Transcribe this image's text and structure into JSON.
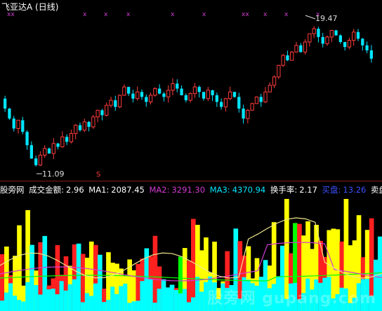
{
  "header": {
    "stock_name": "飞亚达A",
    "period": "(日线)"
  },
  "price_panel": {
    "high_label": "19.47",
    "low_label": "11.09",
    "sell_marker": "S",
    "colors": {
      "up": "#ff3c3c",
      "down": "#00e5ff",
      "signal": "#d23cd2"
    },
    "signals": [
      "xx",
      "x",
      "x",
      "x",
      "x",
      "x",
      "xx",
      "x",
      "x",
      "x"
    ],
    "candles": [
      [
        15.2,
        14.6
      ],
      [
        14.6,
        14.0
      ],
      [
        14.0,
        13.4
      ],
      [
        13.4,
        13.9
      ],
      [
        13.9,
        13.2
      ],
      [
        13.2,
        12.4
      ],
      [
        12.4,
        11.6
      ],
      [
        11.6,
        11.2
      ],
      [
        11.2,
        11.8
      ],
      [
        11.8,
        12.2
      ],
      [
        12.2,
        11.9
      ],
      [
        11.9,
        12.5
      ],
      [
        12.5,
        12.3
      ],
      [
        12.3,
        12.9
      ],
      [
        12.9,
        12.6
      ],
      [
        12.6,
        13.1
      ],
      [
        13.1,
        13.6
      ],
      [
        13.6,
        13.3
      ],
      [
        13.3,
        13.8
      ],
      [
        13.8,
        13.5
      ],
      [
        13.5,
        14.1
      ],
      [
        14.1,
        14.5
      ],
      [
        14.5,
        14.2
      ],
      [
        14.2,
        14.8
      ],
      [
        14.8,
        15.1
      ],
      [
        15.1,
        14.7
      ],
      [
        14.7,
        15.4
      ],
      [
        15.4,
        15.9
      ],
      [
        15.9,
        15.5
      ],
      [
        15.5,
        15.2
      ],
      [
        15.2,
        15.6
      ],
      [
        15.6,
        15.3
      ],
      [
        15.3,
        15.0
      ],
      [
        15.0,
        15.4
      ],
      [
        15.4,
        15.8
      ],
      [
        15.8,
        15.5
      ],
      [
        15.5,
        15.3
      ],
      [
        15.3,
        15.7
      ],
      [
        15.7,
        16.1
      ],
      [
        16.1,
        15.8
      ],
      [
        15.8,
        15.4
      ],
      [
        15.4,
        15.1
      ],
      [
        15.1,
        15.5
      ],
      [
        15.5,
        15.9
      ],
      [
        15.9,
        15.6
      ],
      [
        15.6,
        15.2
      ],
      [
        15.2,
        15.7
      ],
      [
        15.7,
        15.4
      ],
      [
        15.4,
        15.0
      ],
      [
        15.0,
        14.7
      ],
      [
        14.7,
        15.2
      ],
      [
        15.2,
        15.6
      ],
      [
        15.6,
        15.3
      ],
      [
        15.3,
        14.6
      ],
      [
        14.6,
        14.0
      ],
      [
        14.0,
        14.5
      ],
      [
        14.5,
        14.9
      ],
      [
        14.9,
        15.3
      ],
      [
        15.3,
        15.0
      ],
      [
        15.0,
        15.6
      ],
      [
        15.6,
        16.0
      ],
      [
        16.0,
        16.5
      ],
      [
        16.5,
        17.2
      ],
      [
        17.2,
        17.8
      ],
      [
        17.8,
        17.5
      ],
      [
        17.5,
        18.0
      ],
      [
        18.0,
        18.4
      ],
      [
        18.4,
        18.0
      ],
      [
        18.0,
        18.6
      ],
      [
        18.6,
        19.1
      ],
      [
        19.1,
        19.4
      ],
      [
        19.4,
        18.9
      ],
      [
        18.9,
        18.5
      ],
      [
        18.5,
        18.9
      ],
      [
        18.9,
        19.3
      ],
      [
        19.3,
        19.0
      ],
      [
        19.0,
        18.6
      ],
      [
        18.6,
        18.3
      ],
      [
        18.3,
        18.7
      ],
      [
        18.7,
        19.2
      ],
      [
        19.2,
        18.8
      ],
      [
        18.8,
        18.4
      ],
      [
        18.4,
        18.1
      ],
      [
        18.1,
        17.6
      ]
    ]
  },
  "volume_panel": {
    "site_label": "股旁网",
    "amount_label": "成交金额:",
    "amount_value": "2.96",
    "ma1_label": "MA1:",
    "ma1_value": "2087.45",
    "ma2_label": "MA2:",
    "ma2_value": "3291.30",
    "ma3_label": "MA3:",
    "ma3_value": "4370.94",
    "turnover_label": "换手率:",
    "turnover_value": "2.17",
    "buy_label": "买盘:",
    "buy_value": "13.26",
    "sell_label": "卖盘:",
    "colors": {
      "ma1": "#ffffff",
      "ma2": "#d23cd2",
      "ma3": "#00e5ff",
      "buy": "#3c50ff"
    },
    "watermark": "股旁网 gupang.com"
  }
}
